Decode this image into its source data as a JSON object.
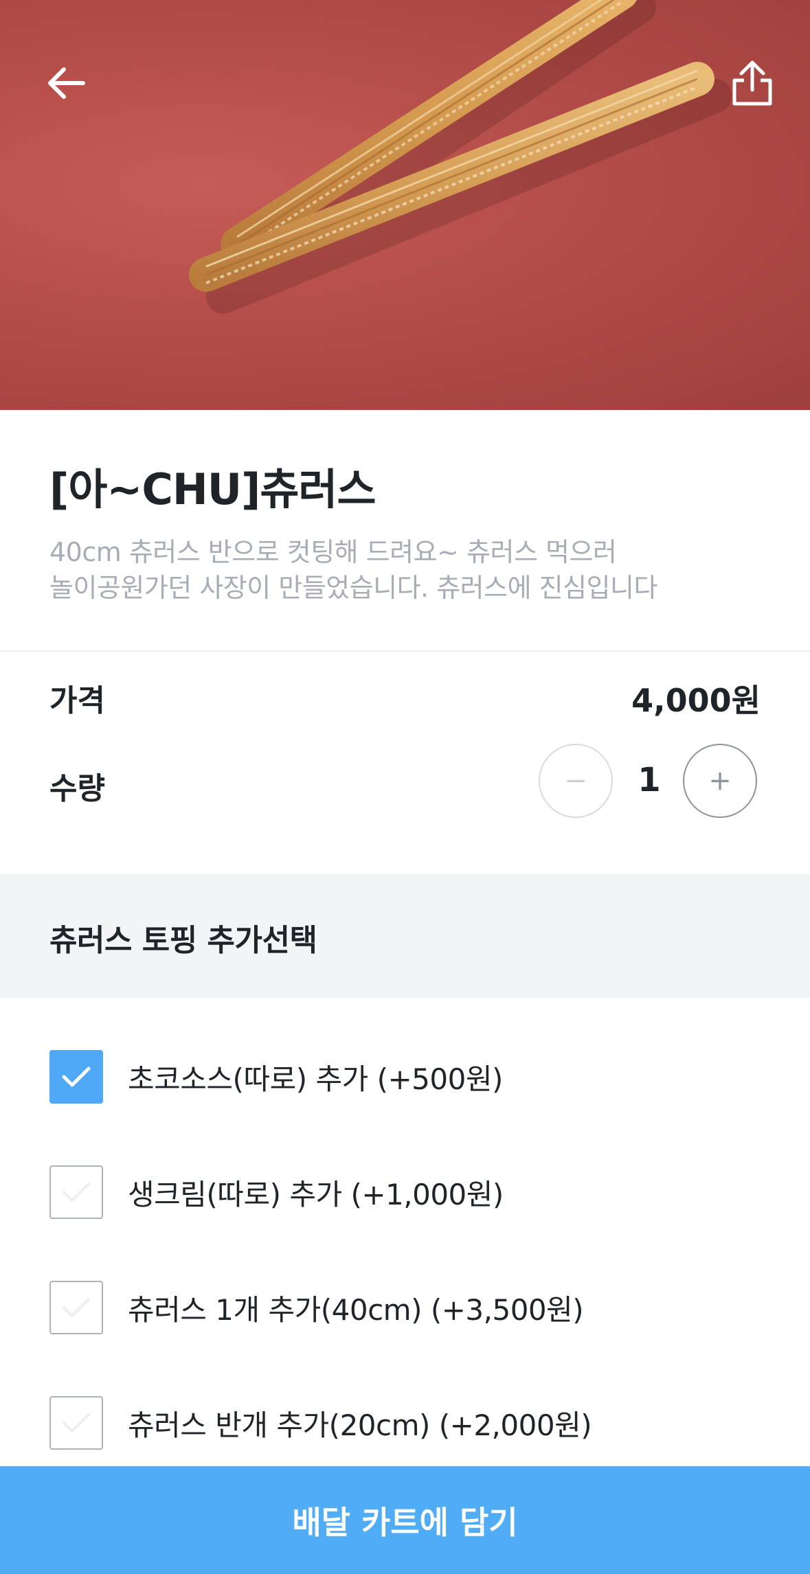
{
  "header": {
    "back_icon": "arrow-left-icon",
    "share_icon": "share-icon",
    "hero_image": "churros-photo"
  },
  "product": {
    "name": "[아~CHU]츄러스",
    "description_line1": "40cm 츄러스 반으로 컷팅해 드려요~ 츄러스 먹으러",
    "description_line2": "놀이공원가던 사장이 만들었습니다. 츄러스에 진심입니다"
  },
  "price": {
    "label": "가격",
    "value": "4,000원"
  },
  "quantity": {
    "label": "수량",
    "value": "1",
    "minus_label": "−",
    "plus_label": "+"
  },
  "options_section": {
    "title": "츄러스 토핑 추가선택",
    "items": [
      {
        "label": "초코소스(따로) 추가 (+500원)",
        "checked": true
      },
      {
        "label": "생크림(따로) 추가 (+1,000원)",
        "checked": false
      },
      {
        "label": "츄러스 1개 추가(40cm) (+3,500원)",
        "checked": false
      },
      {
        "label": "츄러스 반개 추가(20cm) (+2,000원)",
        "checked": false
      }
    ]
  },
  "cta": {
    "label": "배달 카트에 담기"
  },
  "colors": {
    "accent": "#50acf5",
    "checkbox_checked": "#4ea8f5",
    "hero_bg": "#b34d49",
    "text_primary": "#1f2429",
    "text_secondary": "#a7adb4"
  }
}
